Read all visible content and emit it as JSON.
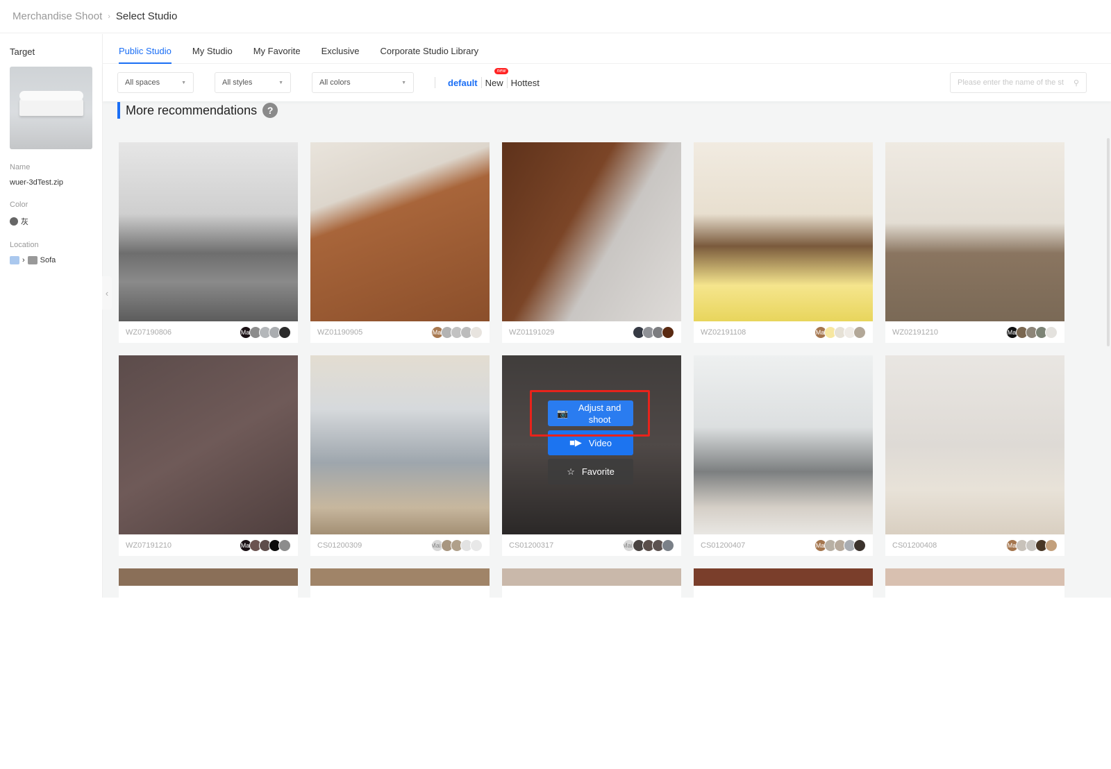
{
  "breadcrumb": {
    "parent": "Merchandise Shoot",
    "current": "Select Studio"
  },
  "sidebar": {
    "title": "Target",
    "name_label": "Name",
    "name_value": "wuer-3dTest.zip",
    "color_label": "Color",
    "color_value": "灰",
    "color_hex": "#666666",
    "location_label": "Location",
    "location_value": "Sofa"
  },
  "tabs": [
    {
      "label": "Public Studio",
      "active": true
    },
    {
      "label": "My Studio"
    },
    {
      "label": "My Favorite"
    },
    {
      "label": "Exclusive"
    },
    {
      "label": "Corporate Studio Library"
    }
  ],
  "filters": {
    "spaces": "All spaces",
    "styles": "All styles",
    "colors": "All colors"
  },
  "sort": {
    "default": "default",
    "new": "New",
    "new_badge": "new",
    "hottest": "Hottest"
  },
  "search": {
    "placeholder": "Please enter the name of the st"
  },
  "section": {
    "title": "More recommendations",
    "help": "?"
  },
  "hover_actions": {
    "adjust": "Adjust and shoot",
    "video": "Video",
    "favorite": "Favorite"
  },
  "cards": [
    {
      "code": "WZ07190806",
      "main": "Mai",
      "colors": [
        "#1a1014",
        "#8c8c8c",
        "#b4b7ba",
        "#aaadb0",
        "#2b2b2b"
      ]
    },
    {
      "code": "WZ01190905",
      "main": "Mai",
      "colors": [
        "#a8784f",
        "#b3b3b3",
        "#c2c2c2",
        "#bcbcbc",
        "#e8e4df"
      ]
    },
    {
      "code": "WZ01191029",
      "main": "",
      "colors": [
        "#ffffff",
        "#363a44",
        "#8f9196",
        "#7c7d80",
        "#5a2a12"
      ]
    },
    {
      "code": "WZ02191108",
      "main": "Mai",
      "colors": [
        "#a5764e",
        "#f7e7a0",
        "#e6e1d6",
        "#efebe6",
        "#b3a898"
      ]
    },
    {
      "code": "WZ02191210",
      "main": "Mai",
      "colors": [
        "#111111",
        "#7a6750",
        "#8d8578",
        "#7c8375",
        "#e4e2de"
      ]
    },
    {
      "code": "WZ07191210",
      "main": "Mai",
      "colors": [
        "#1a1014",
        "#6b5350",
        "#5e4d4b",
        "#0a0a0a",
        "#8c8c8c"
      ]
    },
    {
      "code": "CS01200309",
      "main": "Main",
      "colors": [
        "#d8d8d8",
        "#a89680",
        "#b0a08a",
        "#e2e2e2",
        "#e8e8e8"
      ]
    },
    {
      "code": "CS01200317",
      "main": "Main",
      "colors": [
        "#d8d8d8",
        "#4a4442",
        "#5a4e4a",
        "#5c5250",
        "#7a8088"
      ]
    },
    {
      "code": "CS01200407",
      "main": "Mai",
      "colors": [
        "#a5764e",
        "#b8b0a4",
        "#b7aa9c",
        "#a9adb3",
        "#3b332d"
      ]
    },
    {
      "code": "CS01200408",
      "main": "Mai",
      "colors": [
        "#a5764e",
        "#c8c2ba",
        "#c9c6c1",
        "#4a3826",
        "#c3a07c"
      ]
    }
  ]
}
